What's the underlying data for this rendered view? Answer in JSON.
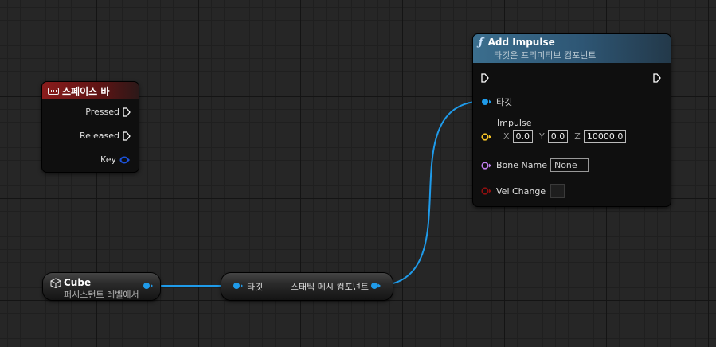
{
  "event_node": {
    "title": "스페이스 바",
    "icon": "keyboard-icon",
    "pins": [
      {
        "label": "Pressed",
        "type": "exec"
      },
      {
        "label": "Released",
        "type": "exec"
      },
      {
        "label": "Key",
        "type": "struct"
      }
    ]
  },
  "function_node": {
    "title": "Add Impulse",
    "subtitle": "타깃은 프리미티브 컴포넌트",
    "icon": "function-icon",
    "target_label": "타깃",
    "impulse": {
      "label": "Impulse",
      "x_label": "X",
      "x": "0.0",
      "y_label": "Y",
      "y": "0.0",
      "z_label": "Z",
      "z": "10000.0"
    },
    "bone_name": {
      "label": "Bone Name",
      "value": "None"
    },
    "vel_change": {
      "label": "Vel Change",
      "checked": false
    }
  },
  "cube_node": {
    "title": "Cube",
    "subtitle": "퍼시스턴트 레벨에서",
    "icon": "cube-icon"
  },
  "cast_node": {
    "input_label": "타깃",
    "output_label": "스태틱 메시 컴포넌트"
  },
  "colors": {
    "object_pin": "#1f9bea",
    "vector_pin": "#f6c326",
    "name_pin": "#c27ff0",
    "bool_pin": "#8f0f0f",
    "struct_pin": "#1c52d9",
    "event_header": "#8a1c1c",
    "function_header": "#3b6e8e"
  }
}
